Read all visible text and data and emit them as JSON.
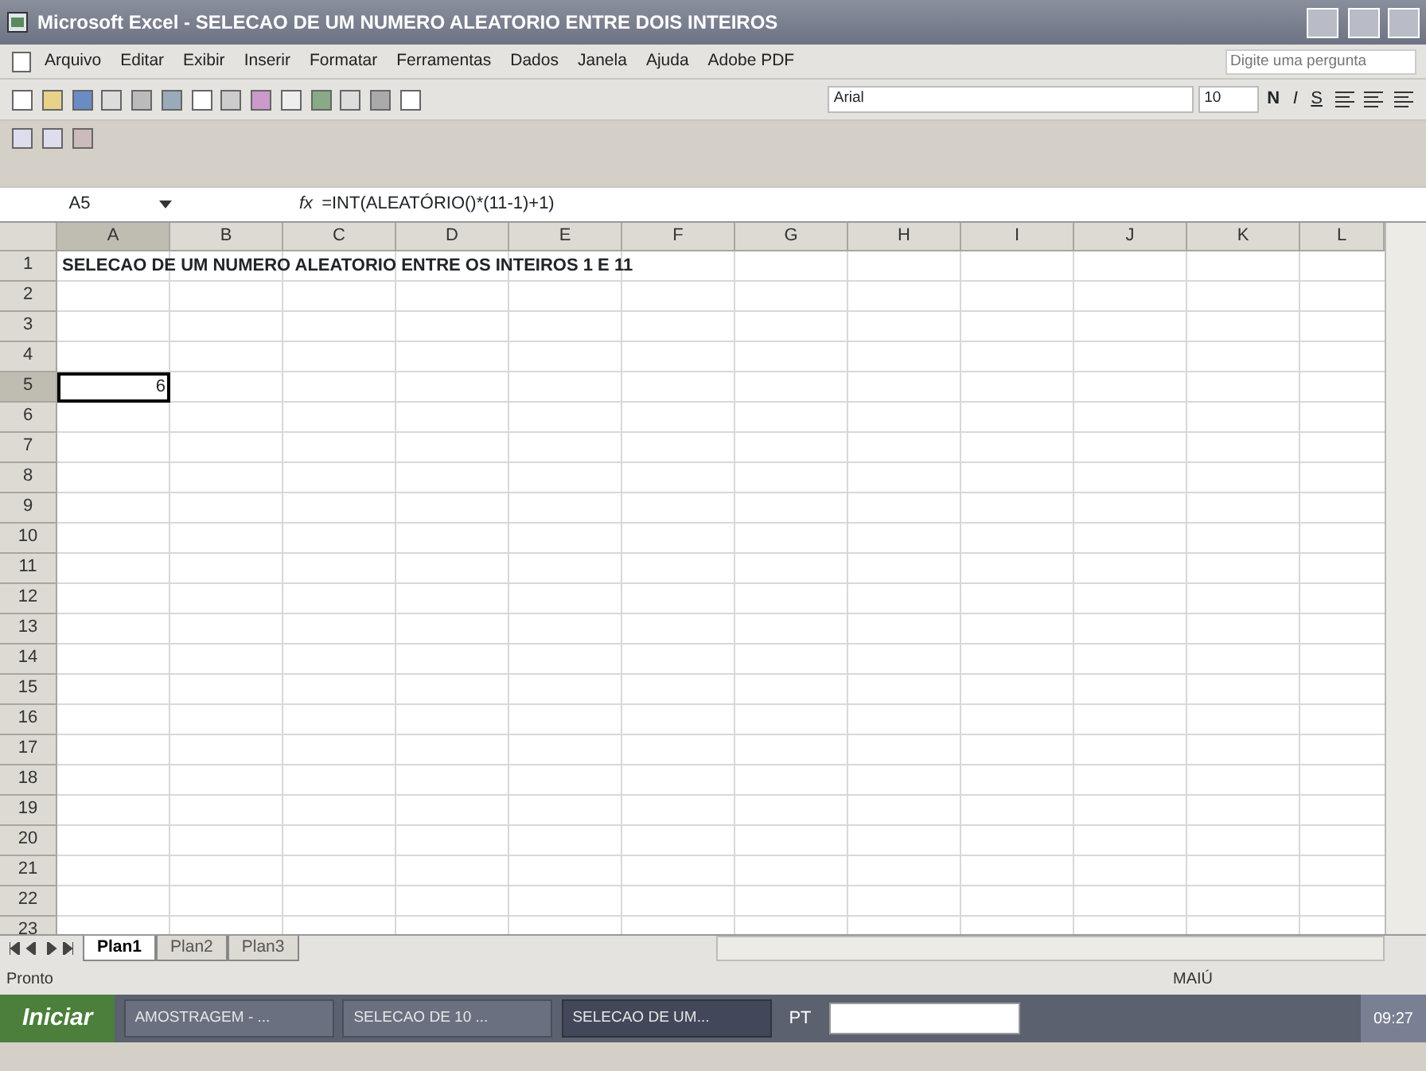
{
  "window": {
    "title": "Microsoft Excel - SELECAO DE UM NUMERO ALEATORIO ENTRE DOIS INTEIROS"
  },
  "menu": [
    "Arquivo",
    "Editar",
    "Exibir",
    "Inserir",
    "Formatar",
    "Ferramentas",
    "Dados",
    "Janela",
    "Ajuda",
    "Adobe PDF"
  ],
  "help_box": {
    "placeholder": "Digite uma pergunta"
  },
  "format_toolbar": {
    "font": "Arial",
    "size": "10",
    "bold": "N",
    "italic": "I",
    "underline": "S"
  },
  "formula_bar": {
    "name_box": "A5",
    "fx": "fx",
    "formula": "=INT(ALEATÓRIO()*(11-1)+1)"
  },
  "sheet": {
    "columns": [
      {
        "label": "A",
        "selected": true
      },
      {
        "label": "B",
        "selected": false
      },
      {
        "label": "C",
        "selected": false
      },
      {
        "label": "D",
        "selected": false
      },
      {
        "label": "E",
        "selected": false
      },
      {
        "label": "F",
        "selected": false
      },
      {
        "label": "G",
        "selected": false
      },
      {
        "label": "H",
        "selected": false
      },
      {
        "label": "I",
        "selected": false
      },
      {
        "label": "J",
        "selected": false
      },
      {
        "label": "K",
        "selected": false
      },
      {
        "label": "L",
        "selected": false
      }
    ],
    "rows": [
      {
        "label": "1",
        "selected": false,
        "cells": [
          {
            "text": "SELECAO DE UM NUMERO ALEATORIO ENTRE OS INTEIROS 1 E 11",
            "bold": true,
            "kind": "text",
            "selected": false
          }
        ]
      },
      {
        "label": "2",
        "selected": false,
        "cells": []
      },
      {
        "label": "3",
        "selected": false,
        "cells": []
      },
      {
        "label": "4",
        "selected": false,
        "cells": []
      },
      {
        "label": "5",
        "selected": true,
        "cells": [
          {
            "text": "6",
            "bold": false,
            "kind": "number",
            "selected": true
          }
        ]
      },
      {
        "label": "6",
        "selected": false,
        "cells": []
      },
      {
        "label": "7",
        "selected": false,
        "cells": []
      },
      {
        "label": "8",
        "selected": false,
        "cells": []
      },
      {
        "label": "9",
        "selected": false,
        "cells": []
      },
      {
        "label": "10",
        "selected": false,
        "cells": []
      },
      {
        "label": "11",
        "selected": false,
        "cells": []
      },
      {
        "label": "12",
        "selected": false,
        "cells": []
      },
      {
        "label": "13",
        "selected": false,
        "cells": []
      },
      {
        "label": "14",
        "selected": false,
        "cells": []
      },
      {
        "label": "15",
        "selected": false,
        "cells": []
      },
      {
        "label": "16",
        "selected": false,
        "cells": []
      },
      {
        "label": "17",
        "selected": false,
        "cells": []
      },
      {
        "label": "18",
        "selected": false,
        "cells": []
      },
      {
        "label": "19",
        "selected": false,
        "cells": []
      },
      {
        "label": "20",
        "selected": false,
        "cells": []
      },
      {
        "label": "21",
        "selected": false,
        "cells": []
      },
      {
        "label": "22",
        "selected": false,
        "cells": []
      },
      {
        "label": "23",
        "selected": false,
        "cells": []
      }
    ]
  },
  "sheet_tabs": [
    {
      "label": "Plan1",
      "selected": true
    },
    {
      "label": "Plan2",
      "selected": false
    },
    {
      "label": "Plan3",
      "selected": false
    }
  ],
  "status_bar": {
    "text": "Pronto",
    "caps": "MAIÚ"
  },
  "taskbar": {
    "start": "Iniciar",
    "tasks": [
      {
        "label": "AMOSTRAGEM - ...",
        "selected": false
      },
      {
        "label": "SELECAO DE 10 ...",
        "selected": false
      },
      {
        "label": "SELECAO DE UM...",
        "selected": true
      }
    ],
    "language": "PT",
    "clock": "09:27"
  }
}
